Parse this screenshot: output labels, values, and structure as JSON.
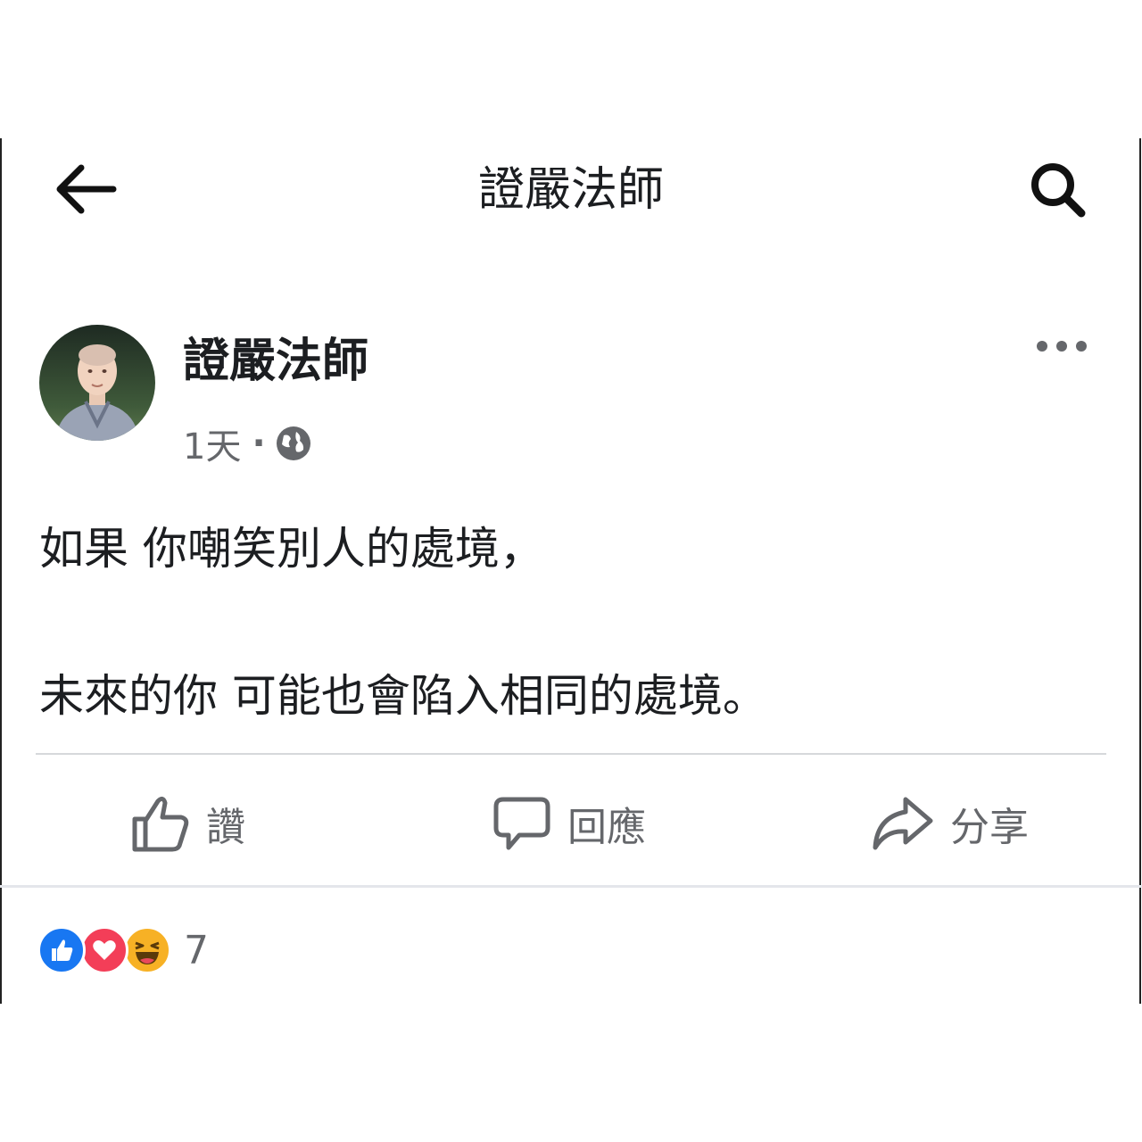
{
  "header": {
    "title": "證嚴法師",
    "back_icon": "arrow-left-icon",
    "search_icon": "search-icon"
  },
  "post": {
    "author": "證嚴法師",
    "time": "1天",
    "separator": "·",
    "privacy_icon": "globe-icon",
    "more_icon": "more-horizontal-icon",
    "lines": [
      "如果 你嘲笑別人的處境，",
      "未來的你 可能也會陷入相同的處境。"
    ]
  },
  "actions": {
    "like_label": "讚",
    "comment_label": "回應",
    "share_label": "分享"
  },
  "reactions": {
    "icons": [
      "like-reaction-icon",
      "love-reaction-icon",
      "haha-reaction-icon"
    ],
    "count": "7"
  },
  "colors": {
    "like": "#1877f2",
    "love": "#f33e58",
    "haha": "#f7b125",
    "secondary_text": "#65676b"
  }
}
